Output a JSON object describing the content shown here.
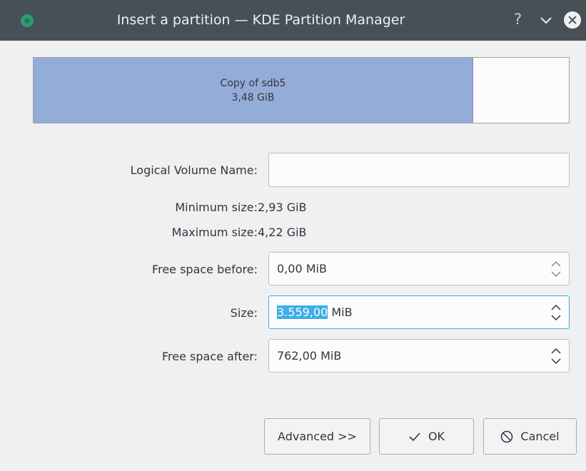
{
  "window": {
    "title": "Insert a partition — KDE Partition Manager",
    "help_label": "?"
  },
  "partition": {
    "name": "Copy of sdb5",
    "size": "3,48 GiB",
    "used_fraction": 0.82
  },
  "form": {
    "lv_name_label": "Logical Volume Name:",
    "lv_name_value": "",
    "min_size_label": "Minimum size:",
    "min_size_value": "2,93 GiB",
    "max_size_label": "Maximum size:",
    "max_size_value": "4,22 GiB",
    "free_before_label": "Free space before:",
    "free_before_value": "0,00 MiB",
    "size_label": "Size:",
    "size_selected": "3.559,00",
    "size_unit": " MiB",
    "free_after_label": "Free space after:",
    "free_after_value": "762,00 MiB"
  },
  "buttons": {
    "advanced": "Advanced >>",
    "ok": "OK",
    "cancel": "Cancel"
  },
  "colors": {
    "titlebar": "#475057",
    "partition_fill": "#94acd8",
    "selection": "#3daee9",
    "background": "#eff0f1"
  }
}
